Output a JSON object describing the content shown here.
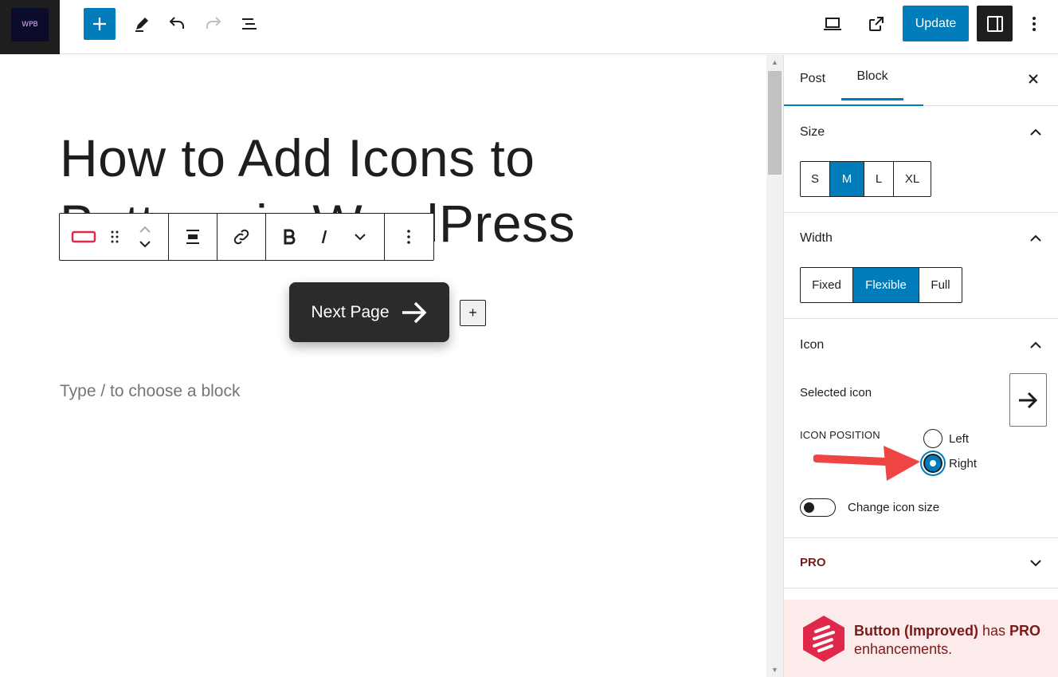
{
  "topbar": {
    "site_logo_text": "WPB",
    "update_label": "Update"
  },
  "editor": {
    "post_title": "How to Add Icons to Buttons in WordPress",
    "button_text": "Next Page",
    "inline_add": "+",
    "placeholder": "Type / to choose a block"
  },
  "sidebar": {
    "tabs": [
      {
        "label": "Post"
      },
      {
        "label": "Block"
      }
    ],
    "size": {
      "title": "Size",
      "options": [
        "S",
        "M",
        "L",
        "XL"
      ],
      "selected": "M"
    },
    "width": {
      "title": "Width",
      "options": [
        "Fixed",
        "Flexible",
        "Full"
      ],
      "selected": "Flexible"
    },
    "icon": {
      "title": "Icon",
      "selected_icon_label": "Selected icon",
      "selected_icon": "arrow-right-icon",
      "position_label": "ICON POSITION",
      "positions": [
        "Left",
        "Right"
      ],
      "position_selected": "Right",
      "toggle_label": "Change icon size",
      "toggle_on": false
    },
    "pro": {
      "title": "PRO"
    },
    "notice": {
      "block_name": "Button (Improved)",
      "has": "has",
      "pro": "PRO",
      "rest": "enhancements."
    }
  },
  "colors": {
    "accent": "#007cba",
    "pro_red": "#7a1a1a",
    "pro_bg": "#fcebeb",
    "button_bg": "#2b2b2b",
    "annotation_arrow": "#ef4444"
  }
}
